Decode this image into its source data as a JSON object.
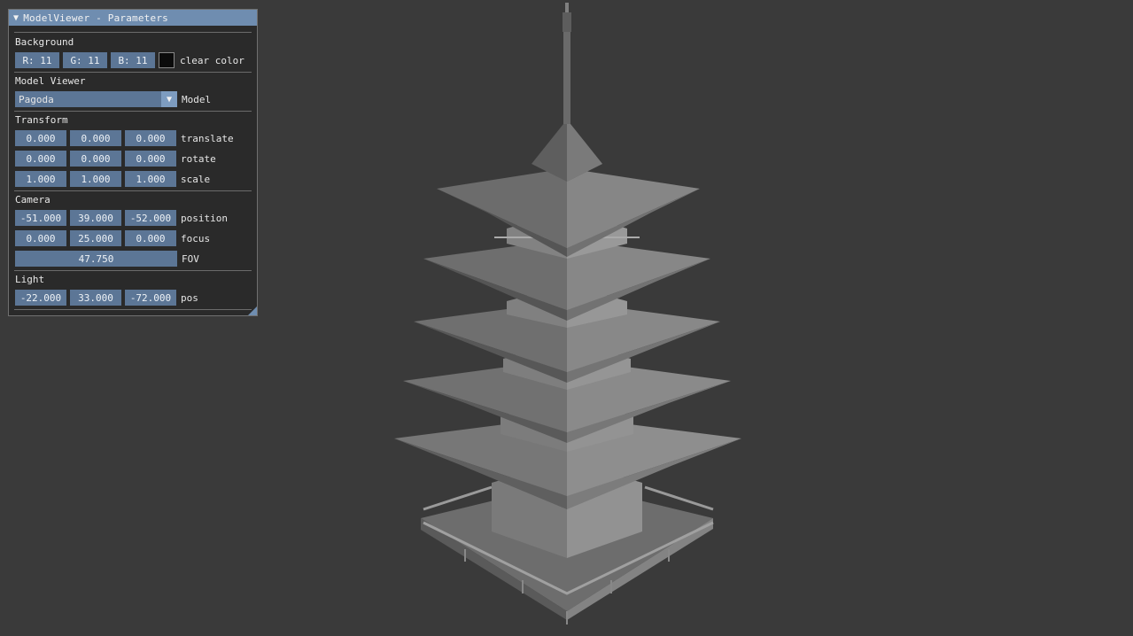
{
  "window": {
    "title": "ModelViewer - Parameters"
  },
  "background": {
    "header": "Background",
    "r": "R: 11",
    "g": "G: 11",
    "b": "B: 11",
    "clear_color_label": "clear color",
    "swatch_color": "#0b0b0b"
  },
  "model_viewer": {
    "header": "Model Viewer",
    "selected": "Pagoda",
    "label": "Model"
  },
  "transform": {
    "header": "Transform",
    "translate": {
      "values": [
        "0.000",
        "0.000",
        "0.000"
      ],
      "label": "translate"
    },
    "rotate": {
      "values": [
        "0.000",
        "0.000",
        "0.000"
      ],
      "label": "rotate"
    },
    "scale": {
      "values": [
        "1.000",
        "1.000",
        "1.000"
      ],
      "label": "scale"
    }
  },
  "camera": {
    "header": "Camera",
    "position": {
      "values": [
        "-51.000",
        "39.000",
        "-52.000"
      ],
      "label": "position"
    },
    "focus": {
      "values": [
        "0.000",
        "25.000",
        "0.000"
      ],
      "label": "focus"
    },
    "fov": {
      "value": "47.750",
      "label": "FOV"
    }
  },
  "light": {
    "header": "Light",
    "pos": {
      "values": [
        "-22.000",
        "33.000",
        "-72.000"
      ],
      "label": "pos"
    }
  },
  "colors": {
    "accent": "#6f8db0",
    "field": "#5c7696",
    "viewport_bg": "#3a3a3a"
  }
}
